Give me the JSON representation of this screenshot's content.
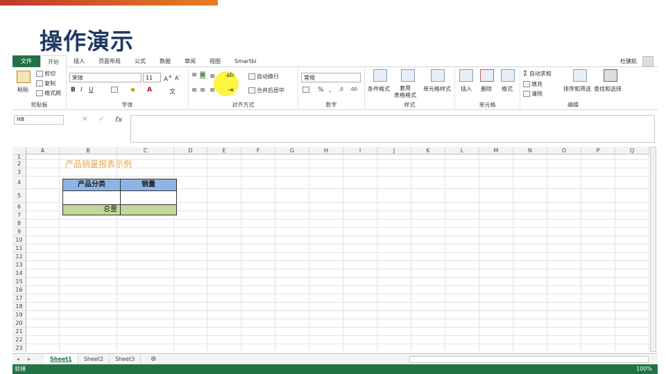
{
  "slide": {
    "title": "操作演示"
  },
  "ribbon": {
    "tabs": [
      "文件",
      "开始",
      "插入",
      "页面布局",
      "公式",
      "数据",
      "审阅",
      "视图",
      "Smartbi"
    ],
    "user": "杜健航",
    "clipboard": {
      "paste": "粘贴",
      "cut": "剪切",
      "copy": "复制",
      "format_painter": "格式刷",
      "label": "剪贴板"
    },
    "font": {
      "family": "宋体",
      "size": "11",
      "label": "字体"
    },
    "alignment": {
      "wrap": "自动换行",
      "merge": "合并后居中",
      "label": "对齐方式"
    },
    "number": {
      "format": "常规",
      "label": "数字"
    },
    "styles": {
      "conditional": "条件格式",
      "table": "套用\n表格格式",
      "cell": "单元格样式",
      "label": "样式"
    },
    "cells": {
      "insert": "插入",
      "delete": "删除",
      "format": "格式",
      "label": "单元格"
    },
    "editing": {
      "autosum": "自动求和",
      "fill": "填充",
      "clear": "清除",
      "sort": "排序和筛选",
      "find": "查找和选择",
      "label": "编辑"
    }
  },
  "formula_bar": {
    "name_box": "H8",
    "fx": "fx"
  },
  "grid": {
    "columns": [
      "A",
      "B",
      "C",
      "D",
      "E",
      "F",
      "G",
      "H",
      "I",
      "J",
      "K",
      "L",
      "M",
      "N",
      "O",
      "P",
      "Q"
    ],
    "rows": [
      "1",
      "2",
      "3",
      "4",
      "5",
      "6",
      "7",
      "8",
      "9",
      "10",
      "11",
      "12",
      "13",
      "14",
      "15",
      "16",
      "17",
      "18",
      "19",
      "20",
      "21",
      "22",
      "23"
    ],
    "title": "产品销量报表示例",
    "header_category": "产品分类",
    "header_sales": "销量",
    "total_label": "总量"
  },
  "sheets": [
    "Sheet1",
    "Sheet2",
    "Sheet3"
  ],
  "status": {
    "ready": "就绪",
    "zoom": "100%"
  }
}
